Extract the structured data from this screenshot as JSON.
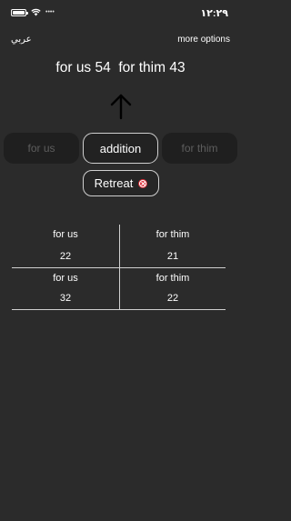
{
  "status_bar": {
    "time": "١٢:٢٩",
    "signal_dots": "••••"
  },
  "nav": {
    "language_label": "عربي",
    "more_options_label": "more options"
  },
  "score": {
    "text": "for us 54  for thim 43"
  },
  "buttons": {
    "us_label": "for us",
    "add_label": "addition",
    "them_label": "for thim",
    "retreat_label": "Retreat"
  },
  "history": {
    "rows": [
      {
        "us_label": "for us",
        "us_value": "22",
        "them_label": "for thim",
        "them_value": "21"
      },
      {
        "us_label": "for us",
        "us_value": "32",
        "them_label": "for thim",
        "them_value": "22"
      }
    ]
  },
  "colors": {
    "background": "#2b2b2b",
    "accent_red": "#e0303a"
  }
}
